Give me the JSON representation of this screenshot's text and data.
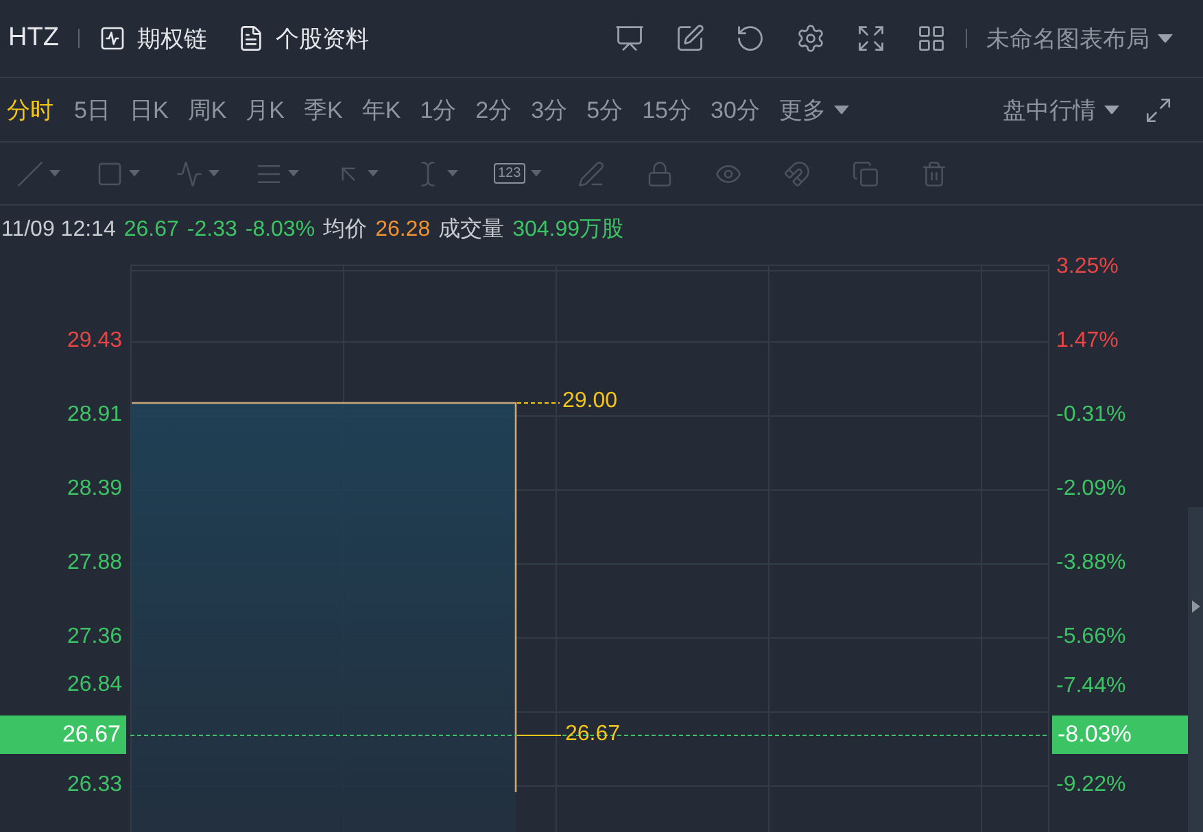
{
  "header": {
    "symbol": "HTZ",
    "links": [
      {
        "kind": "chain",
        "label": "期权链"
      },
      {
        "kind": "profile",
        "label": "个股资料"
      }
    ],
    "actions": [
      {
        "kind": "chart"
      },
      {
        "kind": "edit"
      },
      {
        "kind": "refresh"
      },
      {
        "kind": "settings"
      },
      {
        "kind": "fullscreen"
      },
      {
        "kind": "layout"
      }
    ],
    "layout_name": "未命名图表布局"
  },
  "periods": [
    {
      "label": "分时",
      "selected": true
    },
    {
      "label": "5日",
      "selected": false
    },
    {
      "label": "日K",
      "selected": false
    },
    {
      "label": "周K",
      "selected": false
    },
    {
      "label": "月K",
      "selected": false
    },
    {
      "label": "季K",
      "selected": false
    },
    {
      "label": "年K",
      "selected": false
    },
    {
      "label": "1分",
      "selected": false
    },
    {
      "label": "2分",
      "selected": false
    },
    {
      "label": "3分",
      "selected": false
    },
    {
      "label": "5分",
      "selected": false
    },
    {
      "label": "15分",
      "selected": false
    },
    {
      "label": "30分",
      "selected": false
    }
  ],
  "more": "更多",
  "session": "盘中行情",
  "drawing_tools": {
    "disabled": true,
    "tools": [
      {
        "kind": "line",
        "menu": true
      },
      {
        "kind": "rect",
        "menu": true
      },
      {
        "kind": "pattern",
        "menu": true
      },
      {
        "kind": "fib",
        "menu": true
      },
      {
        "kind": "arrow",
        "menu": true
      },
      {
        "kind": "measure",
        "menu": true
      },
      {
        "kind": "number",
        "menu": true,
        "label": "123"
      },
      {
        "kind": "pen",
        "menu": false
      },
      {
        "kind": "lock",
        "menu": false
      },
      {
        "kind": "eye",
        "menu": false
      },
      {
        "kind": "magnet",
        "menu": false
      },
      {
        "kind": "copy",
        "menu": false
      },
      {
        "kind": "trash",
        "menu": false
      }
    ]
  },
  "quote": [
    {
      "text": "11/09 12:14",
      "color": "#c9ccd1"
    },
    {
      "text": "26.67",
      "color": "#3cc464"
    },
    {
      "text": "-2.33",
      "color": "#3cc464"
    },
    {
      "text": "-8.03%",
      "color": "#3cc464"
    },
    {
      "text": "均价",
      "color": "#c9ccd1"
    },
    {
      "text": "26.28",
      "color": "#f0922e"
    },
    {
      "text": "成交量",
      "color": "#c9ccd1"
    },
    {
      "text": "304.99万股",
      "color": "#3cc464"
    }
  ],
  "chart": {
    "price_axis": [
      {
        "text": "29.43",
        "color": "#e84545"
      },
      {
        "text": "28.91",
        "color": "#3cc464"
      },
      {
        "text": "28.39",
        "color": "#3cc464"
      },
      {
        "text": "27.88",
        "color": "#3cc464"
      },
      {
        "text": "27.36",
        "color": "#3cc464"
      },
      {
        "text": "26.84",
        "color": "#3cc464"
      },
      {
        "text": "26.33",
        "color": "#3cc464"
      }
    ],
    "percent_axis": [
      {
        "text": "3.25%",
        "color": "#e84545"
      },
      {
        "text": "1.47%",
        "color": "#e84545"
      },
      {
        "text": "-0.31%",
        "color": "#3cc464"
      },
      {
        "text": "-2.09%",
        "color": "#3cc464"
      },
      {
        "text": "-3.88%",
        "color": "#3cc464"
      },
      {
        "text": "-5.66%",
        "color": "#3cc464"
      },
      {
        "text": "-7.44%",
        "color": "#3cc464"
      },
      {
        "text": "-9.22%",
        "color": "#3cc464"
      }
    ],
    "high_label": "29.00",
    "last_label": "26.67",
    "last_price_badge": "26.67",
    "last_percent_badge": "-8.03%"
  }
}
